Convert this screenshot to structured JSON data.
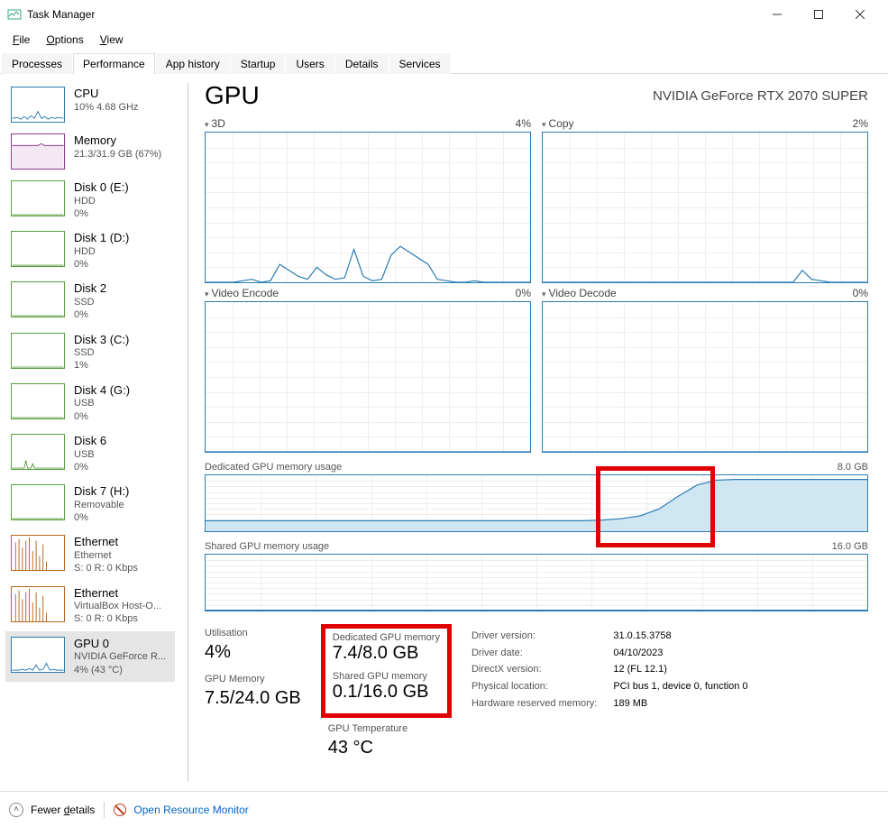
{
  "window": {
    "title": "Task Manager"
  },
  "menu": {
    "file": "File",
    "options": "Options",
    "view": "View"
  },
  "tabs": {
    "processes": "Processes",
    "performance": "Performance",
    "app_history": "App history",
    "startup": "Startup",
    "users": "Users",
    "details": "Details",
    "services": "Services"
  },
  "sidebar": [
    {
      "title": "CPU",
      "line2": "10%  4.68 GHz",
      "line3": "",
      "kind": "cpu"
    },
    {
      "title": "Memory",
      "line2": "21.3/31.9 GB (67%)",
      "line3": "",
      "kind": "mem"
    },
    {
      "title": "Disk 0 (E:)",
      "line2": "HDD",
      "line3": "0%",
      "kind": "disk-green"
    },
    {
      "title": "Disk 1 (D:)",
      "line2": "HDD",
      "line3": "0%",
      "kind": "disk-green"
    },
    {
      "title": "Disk 2",
      "line2": "SSD",
      "line3": "0%",
      "kind": "disk-green"
    },
    {
      "title": "Disk 3 (C:)",
      "line2": "SSD",
      "line3": "1%",
      "kind": "disk-green"
    },
    {
      "title": "Disk 4 (G:)",
      "line2": "USB",
      "line3": "0%",
      "kind": "disk-green"
    },
    {
      "title": "Disk 6",
      "line2": "USB",
      "line3": "0%",
      "kind": "disk-green"
    },
    {
      "title": "Disk 7 (H:)",
      "line2": "Removable",
      "line3": "0%",
      "kind": "disk-green"
    },
    {
      "title": "Ethernet",
      "line2": "Ethernet",
      "line3": "S: 0  R: 0 Kbps",
      "kind": "eth"
    },
    {
      "title": "Ethernet",
      "line2": "VirtualBox Host-O...",
      "line3": "S: 0  R: 0 Kbps",
      "kind": "eth"
    },
    {
      "title": "GPU 0",
      "line2": "NVIDIA GeForce R...",
      "line3": "4%  (43 °C)",
      "kind": "gpu",
      "selected": true
    }
  ],
  "main": {
    "title": "GPU",
    "device": "NVIDIA GeForce RTX 2070 SUPER",
    "graphs": {
      "g3d": {
        "label": "3D",
        "pct": "4%"
      },
      "copy": {
        "label": "Copy",
        "pct": "2%"
      },
      "venc": {
        "label": "Video Encode",
        "pct": "0%"
      },
      "vdec": {
        "label": "Video Decode",
        "pct": "0%"
      }
    },
    "dedicated": {
      "label": "Dedicated GPU memory usage",
      "max": "8.0 GB"
    },
    "shared": {
      "label": "Shared GPU memory usage",
      "max": "16.0 GB"
    },
    "stats": {
      "util_label": "Utilisation",
      "util_value": "4%",
      "gpumem_label": "GPU Memory",
      "gpumem_value": "7.5/24.0 GB",
      "ded_label": "Dedicated GPU memory",
      "ded_value": "7.4/8.0 GB",
      "shr_label": "Shared GPU memory",
      "shr_value": "0.1/16.0 GB",
      "temp_label": "GPU Temperature",
      "temp_value": "43 °C"
    },
    "info": {
      "labels": {
        "drv_ver": "Driver version:",
        "drv_date": "Driver date:",
        "dx": "DirectX version:",
        "loc": "Physical location:",
        "hwres": "Hardware reserved memory:"
      },
      "values": {
        "drv_ver": "31.0.15.3758",
        "drv_date": "04/10/2023",
        "dx": "12 (FL 12.1)",
        "loc": "PCI bus 1, device 0, function 0",
        "hwres": "189 MB"
      }
    }
  },
  "footer": {
    "fewer": "Fewer details",
    "orm": "Open Resource Monitor"
  },
  "chart_data": [
    {
      "type": "line",
      "title": "3D",
      "ylim": [
        0,
        100
      ],
      "series": [
        {
          "name": "3D",
          "values": [
            0,
            0,
            0,
            0,
            1,
            2,
            0,
            1,
            12,
            8,
            4,
            2,
            10,
            5,
            2,
            3,
            22,
            4,
            1,
            2,
            18,
            24,
            20,
            16,
            12,
            2,
            1,
            0,
            0,
            1,
            0,
            0,
            0,
            0,
            0,
            0
          ]
        }
      ]
    },
    {
      "type": "line",
      "title": "Copy",
      "ylim": [
        0,
        100
      ],
      "series": [
        {
          "name": "Copy",
          "values": [
            0,
            0,
            0,
            0,
            0,
            0,
            0,
            0,
            0,
            0,
            0,
            0,
            0,
            0,
            0,
            0,
            0,
            0,
            0,
            0,
            0,
            0,
            0,
            0,
            0,
            0,
            0,
            0,
            8,
            2,
            1,
            0,
            0,
            0,
            0,
            0
          ]
        }
      ]
    },
    {
      "type": "line",
      "title": "Video Encode",
      "ylim": [
        0,
        100
      ],
      "series": [
        {
          "name": "Video Encode",
          "values": [
            0,
            0,
            0,
            0,
            0,
            0,
            0,
            0,
            0,
            0,
            0,
            0,
            0,
            0,
            0,
            0,
            0,
            0,
            0,
            0,
            0,
            0,
            0,
            0,
            0,
            0,
            0,
            0,
            0,
            0,
            0,
            0,
            0,
            0,
            0,
            0
          ]
        }
      ]
    },
    {
      "type": "line",
      "title": "Video Decode",
      "ylim": [
        0,
        100
      ],
      "series": [
        {
          "name": "Video Decode",
          "values": [
            0,
            0,
            0,
            0,
            0,
            0,
            0,
            0,
            0,
            0,
            0,
            0,
            0,
            0,
            0,
            0,
            0,
            0,
            0,
            0,
            0,
            0,
            0,
            0,
            0,
            0,
            0,
            0,
            0,
            0,
            0,
            0,
            0,
            0,
            0,
            0
          ]
        }
      ]
    },
    {
      "type": "area",
      "title": "Dedicated GPU memory usage",
      "ylabel": "GB",
      "ylim": [
        0,
        8.0
      ],
      "series": [
        {
          "name": "Dedicated",
          "values": [
            1.5,
            1.5,
            1.5,
            1.5,
            1.5,
            1.5,
            1.5,
            1.5,
            1.5,
            1.5,
            1.5,
            1.5,
            1.5,
            1.5,
            1.5,
            1.5,
            1.5,
            1.5,
            1.5,
            1.5,
            1.5,
            1.6,
            1.8,
            2.2,
            3.2,
            5.0,
            6.6,
            7.3,
            7.4,
            7.4,
            7.4,
            7.4,
            7.4,
            7.4,
            7.4,
            7.4
          ]
        }
      ]
    },
    {
      "type": "area",
      "title": "Shared GPU memory usage",
      "ylabel": "GB",
      "ylim": [
        0,
        16.0
      ],
      "series": [
        {
          "name": "Shared",
          "values": [
            0.1,
            0.1,
            0.1,
            0.1,
            0.1,
            0.1,
            0.1,
            0.1,
            0.1,
            0.1,
            0.1,
            0.1,
            0.1,
            0.1,
            0.1,
            0.1,
            0.1,
            0.1,
            0.1,
            0.1,
            0.1,
            0.1,
            0.1,
            0.1,
            0.1,
            0.1,
            0.1,
            0.1,
            0.1,
            0.1,
            0.1,
            0.1,
            0.1,
            0.1,
            0.1,
            0.1
          ]
        }
      ]
    }
  ]
}
